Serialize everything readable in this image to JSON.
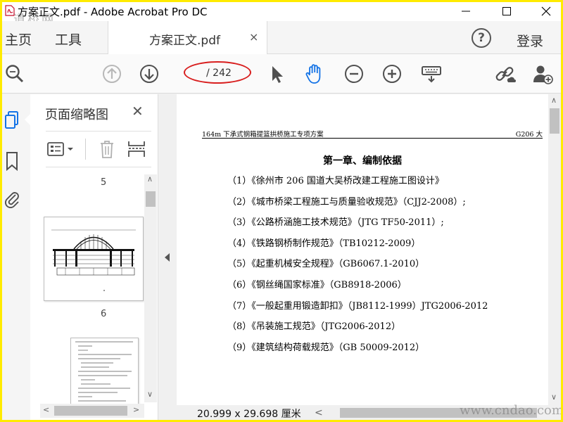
{
  "window": {
    "title": "方案正文.pdf - Adobe Acrobat Pro DC",
    "watermark_top_left": "道桥网",
    "watermark_bottom_right": "www.cndao.com"
  },
  "tabbar": {
    "home": "主页",
    "tools": "工具",
    "document_tab": "方案正文.pdf",
    "close_tab": "×",
    "help": "?",
    "login": "登录"
  },
  "toolbar": {
    "page_current": "",
    "page_total": "/ 242",
    "icons": [
      "search-zoom-icon",
      "page-up-icon",
      "page-down-icon",
      "select-cursor-icon",
      "hand-tool-icon",
      "zoom-out-icon",
      "zoom-in-icon",
      "keyboard-icon",
      "link-share-icon",
      "add-person-icon"
    ]
  },
  "sidebar": {
    "panel_title": "页面缩略图",
    "close": "✕",
    "thumbnails": [
      {
        "label": "5"
      },
      {
        "label": "6"
      }
    ]
  },
  "document": {
    "running_header_left": "164m 下承式钢箱提篮拱桥施工专项方案",
    "running_header_right": "G206 大",
    "chapter_title": "第一章、编制依据",
    "references": [
      "（1）《徐州市 206 国道大吴桥改建工程施工图设计》",
      "（2）《城市桥梁工程施工与质量验收规范》（CJJ2-2008）;",
      "（3）《公路桥涵施工技术规范》（JTG TF50-2011）;",
      "（4）《铁路钢桥制作规范》（TB10212-2009）",
      "（5）《起重机械安全规程》（GB6067.1-2010）",
      "（6）《钢丝绳国家标准》（GB8918-2006）",
      "（7）《一般起重用锻造卸扣》（JB8112-1999）JTG2006-2012",
      "（8）《吊装施工规范》（JTG2006-2012）",
      "（9）《建筑结构荷载规范》（GB 50009-2012）"
    ]
  },
  "statusbar": {
    "page_size": "20.999 x 29.698 厘米"
  },
  "colors": {
    "frame": "#ffeb00",
    "accent_blue": "#1473e6",
    "highlight_red": "#d81e1e"
  }
}
